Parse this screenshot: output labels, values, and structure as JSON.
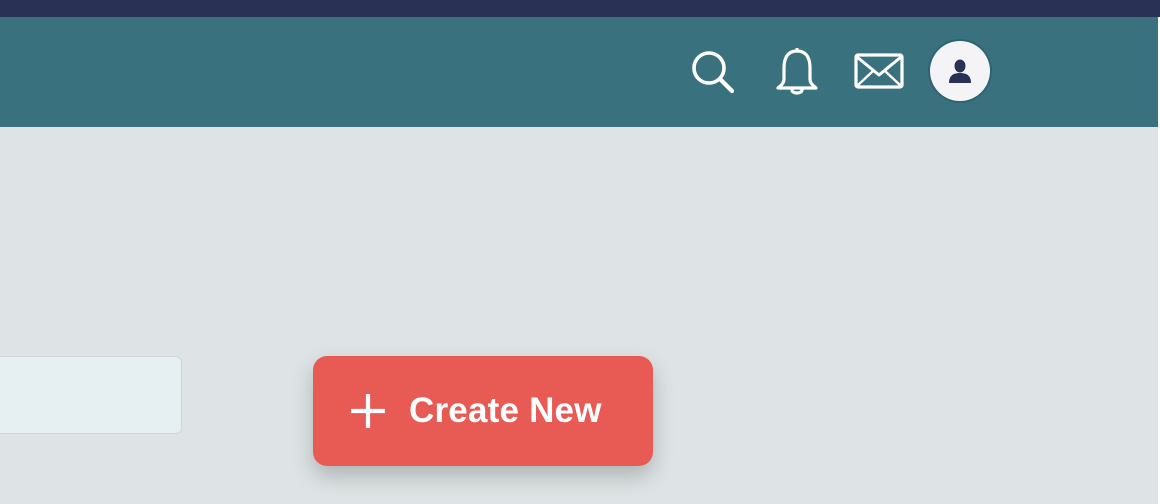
{
  "header": {
    "icons": {
      "search": "search-icon",
      "notifications": "bell-icon",
      "messages": "mail-icon",
      "profile": "user-icon"
    }
  },
  "main": {
    "input": {
      "value": "",
      "placeholder": ""
    },
    "create_button": {
      "label": "Create New",
      "icon": "plus-icon"
    }
  },
  "colors": {
    "top_strip": "#293255",
    "header": "#3a717f",
    "background": "#dee4e5",
    "button": "#e85b55",
    "avatar_bg": "#f4f4f7",
    "avatar_glyph": "#293255"
  }
}
